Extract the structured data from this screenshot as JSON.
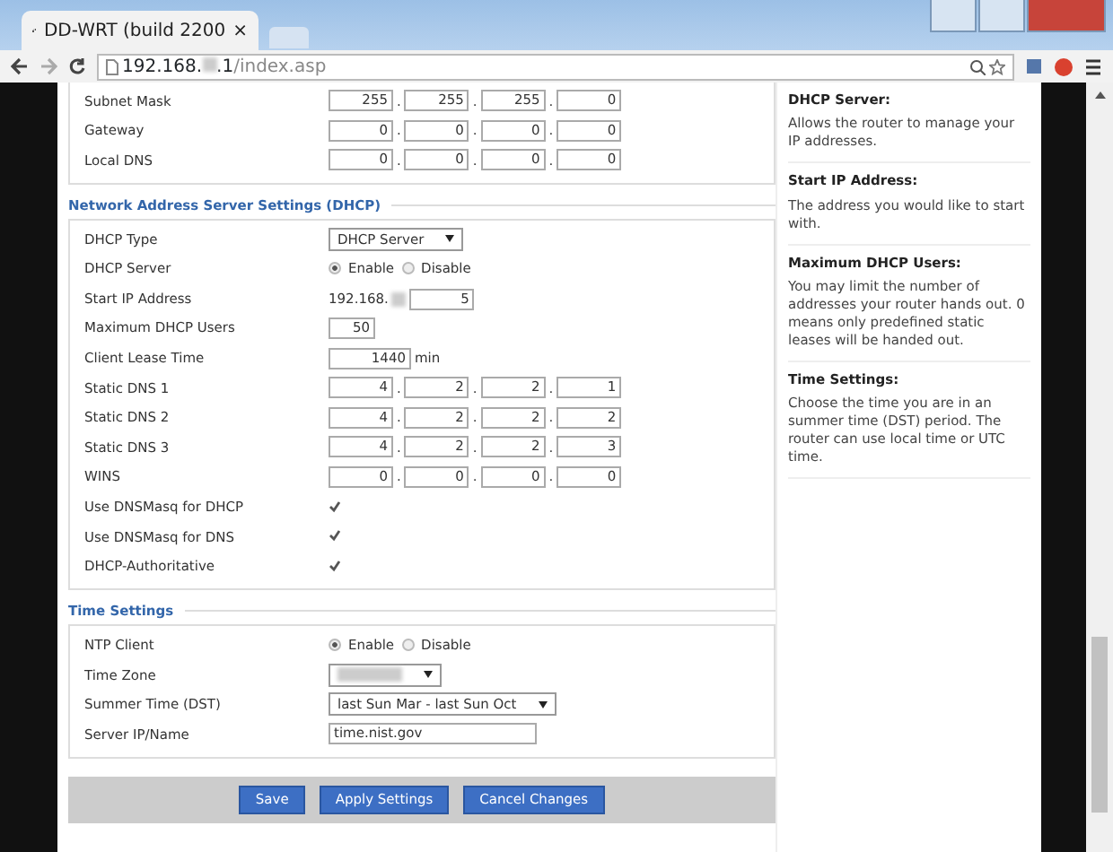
{
  "browser": {
    "tab_title": "DD-WRT (build 2200",
    "tab_close": "×",
    "url_host_start": "192.168.",
    "url_host_end": ".1",
    "url_path": "/index.asp"
  },
  "top_section": {
    "rows": [
      {
        "kind": "ip",
        "label": "Subnet Mask",
        "octets": [
          "255",
          "255",
          "255",
          "0"
        ],
        "dots": [
          ".",
          ".",
          "."
        ]
      },
      {
        "kind": "ip",
        "label": "Gateway",
        "octets": [
          "0",
          "0",
          "0",
          "0"
        ],
        "dots": [
          ".",
          ".",
          "."
        ]
      },
      {
        "kind": "ip",
        "label": "Local DNS",
        "octets": [
          "0",
          "0",
          "0",
          "0"
        ],
        "dots": [
          ".",
          ".",
          "."
        ]
      }
    ]
  },
  "dhcp_section": {
    "legend": "Network Address Server Settings (DHCP)",
    "rows": [
      {
        "kind": "select",
        "label": "DHCP Type",
        "value": "DHCP Server"
      },
      {
        "kind": "radio",
        "label": "DHCP Server",
        "options": [
          {
            "label": "Enable",
            "selected": true
          },
          {
            "label": "Disable",
            "selected": false
          }
        ]
      },
      {
        "kind": "prefix",
        "label": "Start IP Address",
        "prefix": "192.168.",
        "value": "5"
      },
      {
        "kind": "text",
        "label": "Maximum DHCP Users",
        "value": "50"
      },
      {
        "kind": "text",
        "label": "Client Lease Time",
        "value": "1440",
        "unit": "min"
      },
      {
        "kind": "ip",
        "label": "Static DNS 1",
        "octets": [
          "4",
          "2",
          "2",
          "1"
        ],
        "dots": [
          ".",
          ".",
          "."
        ]
      },
      {
        "kind": "ip",
        "label": "Static DNS 2",
        "octets": [
          "4",
          "2",
          "2",
          "2"
        ],
        "dots": [
          ".",
          ".",
          "."
        ]
      },
      {
        "kind": "ip",
        "label": "Static DNS 3",
        "octets": [
          "4",
          "2",
          "2",
          "3"
        ],
        "dots": [
          ".",
          ".",
          "."
        ]
      },
      {
        "kind": "ip",
        "label": "WINS",
        "octets": [
          "0",
          "0",
          "0",
          "0"
        ],
        "dots": [
          ".",
          ".",
          "."
        ]
      },
      {
        "kind": "checkbox",
        "label": "Use DNSMasq for DHCP",
        "checked": true
      },
      {
        "kind": "checkbox",
        "label": "Use DNSMasq for DNS",
        "checked": true
      },
      {
        "kind": "checkbox",
        "label": "DHCP-Authoritative",
        "checked": true
      }
    ]
  },
  "time_section": {
    "legend": "Time Settings",
    "rows": [
      {
        "kind": "radio",
        "label": "NTP Client",
        "options": [
          {
            "label": "Enable",
            "selected": true
          },
          {
            "label": "Disable",
            "selected": false
          }
        ]
      },
      {
        "kind": "blurselect",
        "label": "Time Zone"
      },
      {
        "kind": "select",
        "label": "Summer Time (DST)",
        "value": "last Sun Mar - last Sun Oct"
      },
      {
        "kind": "wide",
        "label": "Server IP/Name",
        "value": "time.nist.gov"
      }
    ]
  },
  "buttons": [
    "Save",
    "Apply Settings",
    "Cancel Changes"
  ],
  "help": [
    {
      "title": "DHCP Server:",
      "text": "Allows the router to manage your IP addresses."
    },
    {
      "title": "Start IP Address:",
      "text": "The address you would like to start with."
    },
    {
      "title": "Maximum DHCP Users:",
      "text": "You may limit the number of addresses your router hands out. 0 means only predefined static leases will be handed out."
    },
    {
      "title": "Time Settings:",
      "text": "Choose the time you are in an summer time (DST) period. The router can use local time or UTC time."
    }
  ]
}
